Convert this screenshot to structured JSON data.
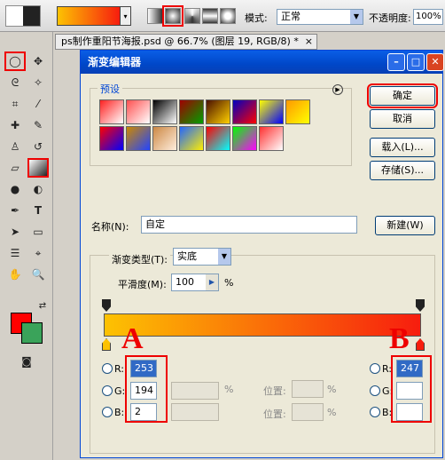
{
  "optionsbar": {
    "dropdown_arrow": "▾",
    "mode_label": "模式:",
    "mode_value": "正常",
    "opacity_label": "不透明度:",
    "opacity_value": "100%"
  },
  "document_tab": {
    "title": "ps制作重阳节海报.psd @ 66.7% (图层 19, RGB/8) *",
    "close": "×"
  },
  "dialog": {
    "title": "渐变编辑器",
    "buttons": {
      "ok": "确定",
      "cancel": "取消",
      "load": "载入(L)...",
      "save": "存储(S)...",
      "new": "新建(W)"
    },
    "presets": {
      "label": "预设",
      "swatches": [
        [
          "#ff2020",
          "#ffffff"
        ],
        [
          "#ff5050",
          "#ffffff"
        ],
        [
          "#000000",
          "#ffffff"
        ],
        [
          "#a00000",
          "#00a000"
        ],
        [
          "#4a1000",
          "#ffd000"
        ],
        [
          "#0000c0",
          "#ff0000"
        ],
        [
          "#ffff00",
          "#0000ff"
        ],
        [
          "#ff9900",
          "#ffff00"
        ],
        [
          "#ff0000",
          "#0000ff"
        ],
        [
          "#cc8800",
          "#2244ff"
        ],
        [
          "#cc8844",
          "#ffeedd"
        ],
        [
          "#2266ff",
          "#ffee00"
        ],
        [
          "#ff0000",
          "#00ffff"
        ],
        [
          "#00ff00",
          "#ff00ff"
        ],
        [
          "#ff3030",
          "#ffffff"
        ]
      ]
    },
    "name_label": "名称(N):",
    "name_value": "自定",
    "gradient": {
      "type_label": "渐变类型(T):",
      "type_value": "实底",
      "smoothness_label": "平滑度(M):",
      "smoothness_value": "100",
      "smoothness_unit": "%",
      "start_color": "#fdc202",
      "end_color": "#f71d0e"
    },
    "stop_a": {
      "letter": "A",
      "r_label": "R:",
      "g_label": "G:",
      "b_label": "B:",
      "r": "253",
      "g": "194",
      "b": "2"
    },
    "stop_b": {
      "letter": "B",
      "r_label": "R:",
      "g_label": "G:",
      "b_label": "B:",
      "r": "247"
    },
    "position_label": "位置:",
    "percent": "%"
  },
  "colors": {
    "foreground": "#ff0000",
    "background": "#3aa35a"
  }
}
